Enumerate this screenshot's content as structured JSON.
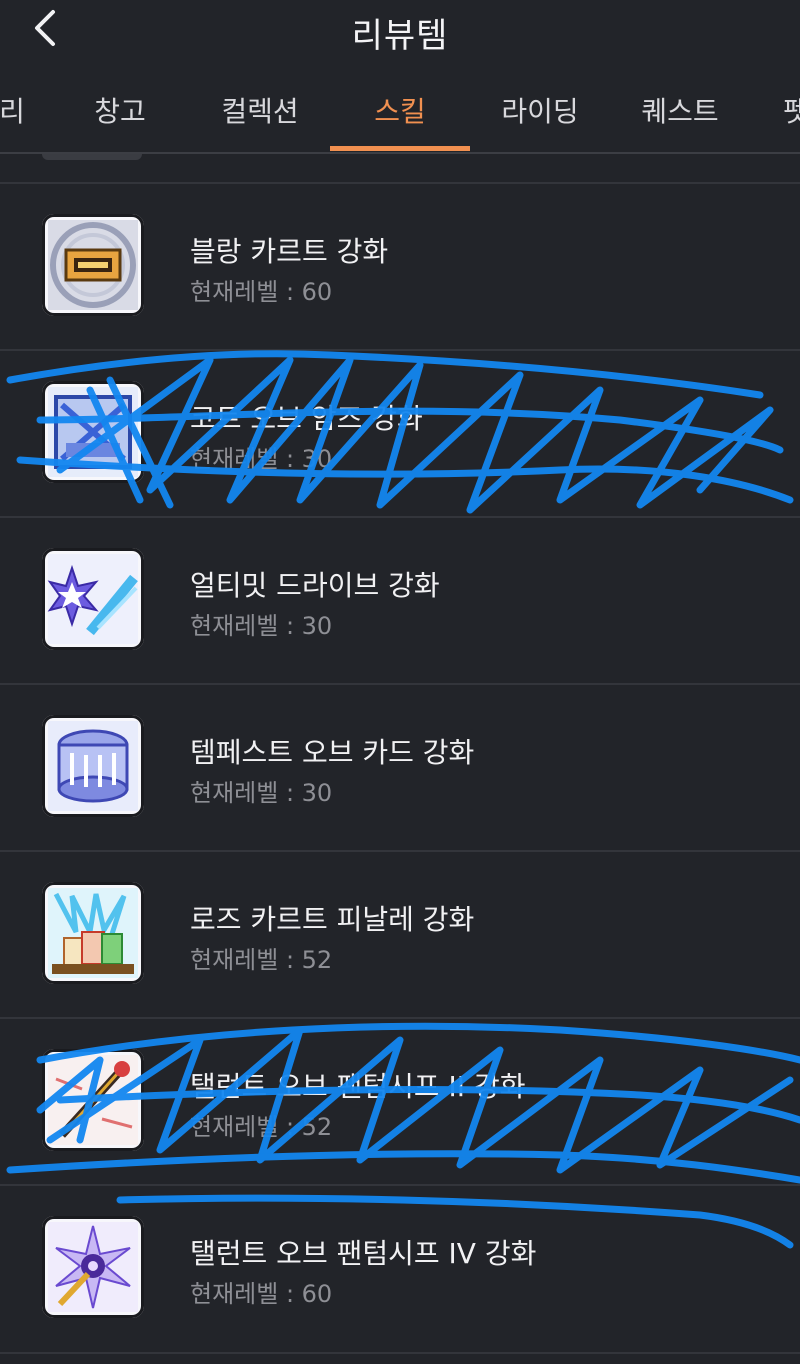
{
  "header": {
    "title": "리뷰템",
    "back_icon": "chevron-left-icon"
  },
  "tabs": [
    {
      "label": "리",
      "active": false
    },
    {
      "label": "창고",
      "active": false
    },
    {
      "label": "컬렉션",
      "active": false
    },
    {
      "label": "스킬",
      "active": true
    },
    {
      "label": "라이딩",
      "active": false
    },
    {
      "label": "퀘스트",
      "active": false
    },
    {
      "label": "펫",
      "active": false
    }
  ],
  "accent_color": "#f19050",
  "skills": [
    {
      "name": "블랑 카르트 강화",
      "level": "현재레벨 : 60",
      "icon": "card-icon"
    },
    {
      "name": "코트 오브 암즈 강화",
      "level": "현재레벨 : 30",
      "icon": "coat-of-arms-icon"
    },
    {
      "name": "얼티밋 드라이브 강화",
      "level": "현재레벨 : 30",
      "icon": "burst-icon"
    },
    {
      "name": "템페스트 오브 카드 강화",
      "level": "현재레벨 : 30",
      "icon": "card-drum-icon"
    },
    {
      "name": "로즈 카르트 피날레 강화",
      "level": "현재레벨 : 52",
      "icon": "rose-cards-icon"
    },
    {
      "name": "탤런트 오브 팬텀시프 II 강화",
      "level": "현재레벨 : 52",
      "icon": "cane-icon"
    },
    {
      "name": "탤런트 오브 팬텀시프 IV 강화",
      "level": "현재레벨 : 60",
      "icon": "star-cane-icon"
    }
  ],
  "scribble_color": "#1387f0"
}
